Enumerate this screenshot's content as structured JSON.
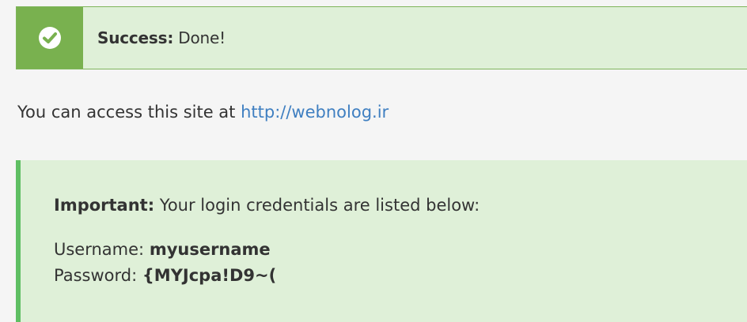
{
  "success_alert": {
    "icon": "check-circle-icon",
    "label": "Success:",
    "message": " Done!"
  },
  "access": {
    "prefix": "You can access this site at ",
    "url": "http://webnolog.ir"
  },
  "credentials": {
    "important_label": "Important:",
    "important_text": " Your login credentials are listed below:",
    "username_label": "Username: ",
    "username": "myusername",
    "password_label": "Password: ",
    "password": "{MYJcpa!D9~("
  },
  "colors": {
    "success_background": "#dff0d8",
    "success_icon_background": "#79b14f",
    "link": "#3f7fc1",
    "credentials_accent": "#5fbf63"
  }
}
